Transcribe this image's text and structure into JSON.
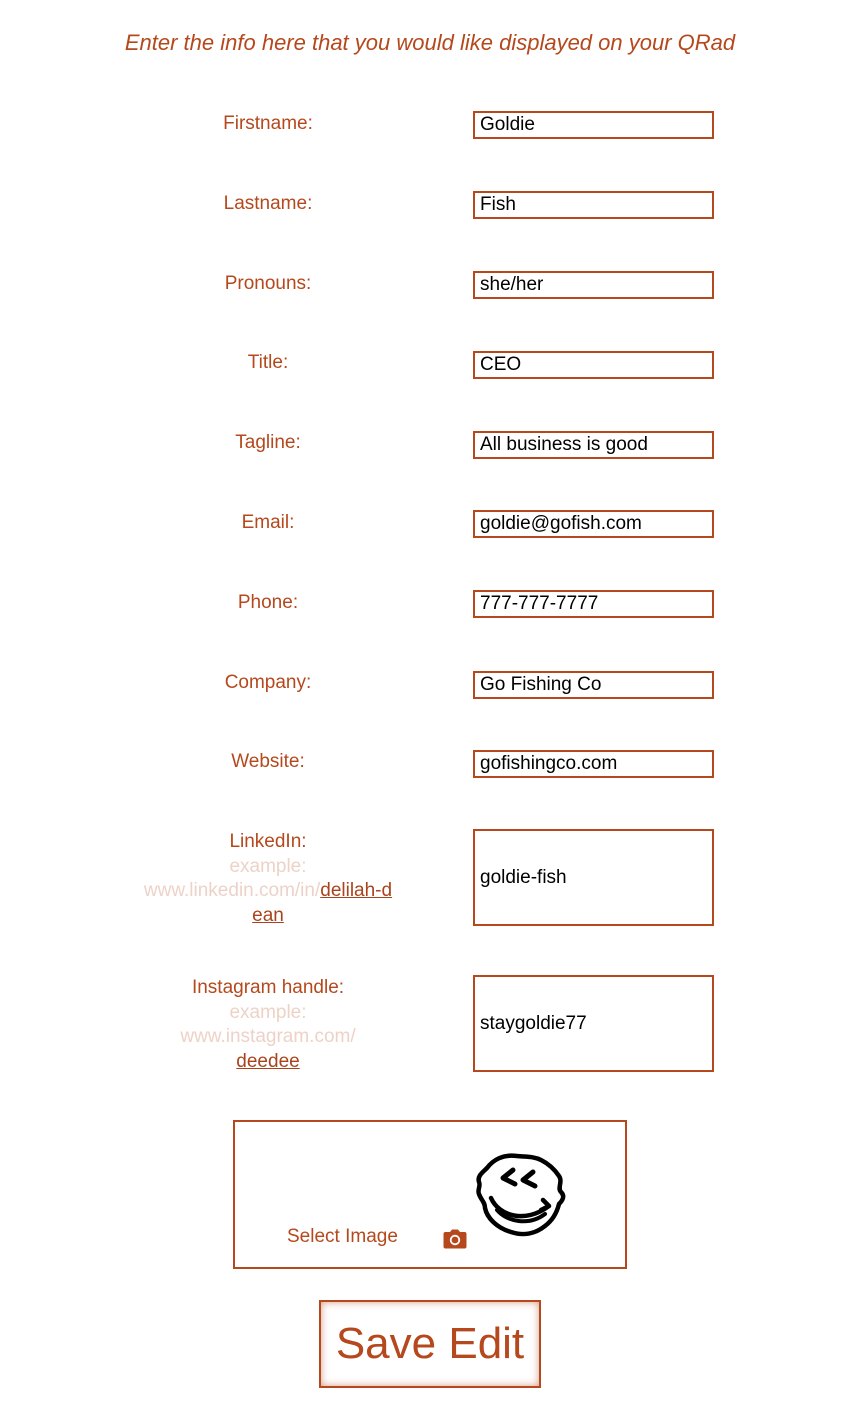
{
  "form": {
    "heading": "Enter the info here that you would like displayed on your QRad",
    "fields": {
      "firstname": {
        "label": "Firstname:",
        "value": "Goldie"
      },
      "lastname": {
        "label": "Lastname:",
        "value": "Fish"
      },
      "pronouns": {
        "label": "Pronouns:",
        "value": "she/her"
      },
      "title": {
        "label": "Title:",
        "value": "CEO"
      },
      "tagline": {
        "label": "Tagline:",
        "value": "All business is good"
      },
      "email": {
        "label": "Email:",
        "value": "goldie@gofish.com"
      },
      "phone": {
        "label": "Phone:",
        "value": "777-777-7777"
      },
      "company": {
        "label": "Company:",
        "value": "Go Fishing Co"
      },
      "website": {
        "label": "Website:",
        "value": "gofishingco.com"
      },
      "linkedin": {
        "label": "LinkedIn:",
        "example_prefix": "example:",
        "example_url": "www.linkedin.com/in/",
        "example_link": "delilah-dean",
        "value": "goldie-fish"
      },
      "instagram": {
        "label": "Instagram handle:",
        "example_prefix": "example:",
        "example_url": "www.instagram.com/",
        "example_link": "deedee",
        "value": "staygoldie77"
      }
    },
    "image": {
      "select_label": "Select Image",
      "camera_icon": "camera-icon",
      "preview_icon": "smiley-face-icon"
    },
    "save_label": "Save Edit"
  },
  "colors": {
    "accent": "#b5481c",
    "example_text": "#edd2c7",
    "field_text": "#000000"
  }
}
